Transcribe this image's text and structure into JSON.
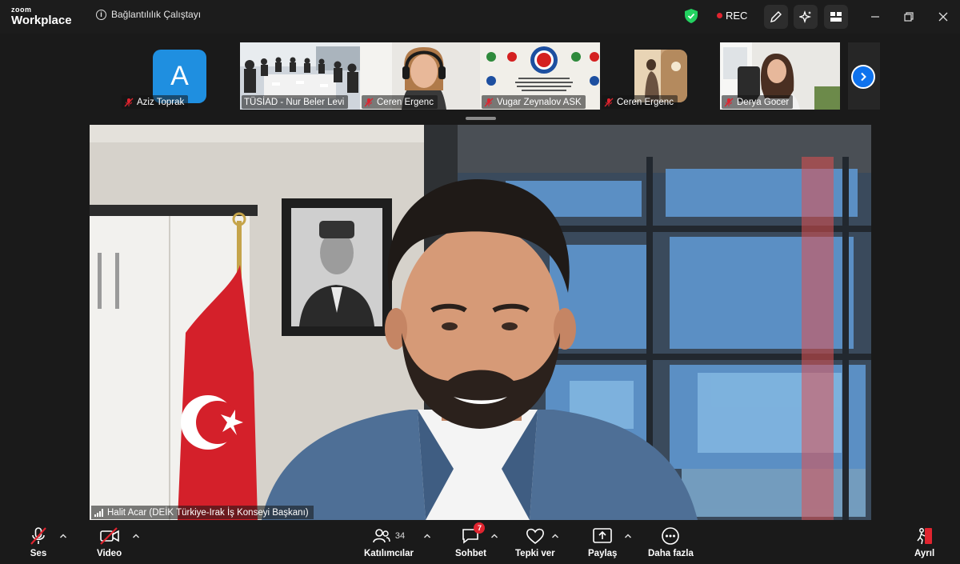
{
  "app": {
    "brand_small": "zoom",
    "brand_large": "Workplace"
  },
  "meeting": {
    "title": "Bağlantılılık Çalıştayı",
    "recording_label": "REC"
  },
  "thumbnails": [
    {
      "name": "Aziz Toprak",
      "avatar_letter": "A",
      "muted": true
    },
    {
      "name": "TÜSİAD - Nur Beler Levi",
      "muted": false
    },
    {
      "name": "Ceren Ergenc",
      "muted": true
    },
    {
      "name": "Vugar Zeynalov ASK",
      "muted": true
    },
    {
      "name": "Ceren Ergenc",
      "muted": true
    },
    {
      "name": "Derya Gocer",
      "muted": true
    }
  ],
  "main_speaker": {
    "name": "Halit Acar (DEİK Türkiye-Irak İş Konseyi Başkanı)"
  },
  "toolbar": {
    "audio_label": "Ses",
    "video_label": "Video",
    "participants_label": "Katılımcılar",
    "participants_count": "34",
    "chat_label": "Sohbet",
    "chat_badge": "7",
    "reactions_label": "Tepki ver",
    "share_label": "Paylaş",
    "more_label": "Daha fazla",
    "leave_label": "Ayrıl"
  },
  "colors": {
    "accent": "#0e72ed",
    "danger": "#e0242f",
    "secure": "#23d160",
    "background": "#1a1a1a"
  }
}
